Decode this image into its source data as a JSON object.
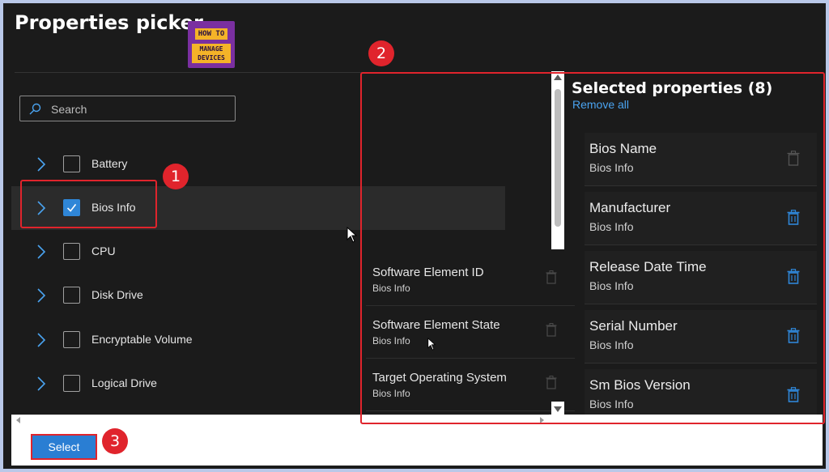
{
  "title": "Properties picker",
  "logo": {
    "line1": "HOW TO",
    "line2": "MANAGE",
    "line3": "DEVICES"
  },
  "search": {
    "placeholder": "Search"
  },
  "tree": [
    {
      "label": "Battery",
      "checked": false
    },
    {
      "label": "Bios Info",
      "checked": true
    },
    {
      "label": "CPU",
      "checked": false
    },
    {
      "label": "Disk Drive",
      "checked": false
    },
    {
      "label": "Encryptable Volume",
      "checked": false
    },
    {
      "label": "Logical Drive",
      "checked": false
    }
  ],
  "available": [
    {
      "name": "Software Element ID",
      "category": "Bios Info"
    },
    {
      "name": "Software Element State",
      "category": "Bios Info"
    },
    {
      "name": "Target Operating System",
      "category": "Bios Info"
    }
  ],
  "selected_panel": {
    "title": "Selected properties (8)",
    "remove_all": "Remove all",
    "items": [
      {
        "name": "Bios Name",
        "category": "Bios Info"
      },
      {
        "name": "Manufacturer",
        "category": "Bios Info"
      },
      {
        "name": "Release Date Time",
        "category": "Bios Info"
      },
      {
        "name": "Serial Number",
        "category": "Bios Info"
      },
      {
        "name": "Sm Bios Version",
        "category": "Bios Info"
      }
    ]
  },
  "footer": {
    "select_label": "Select"
  },
  "annotations": {
    "badge1": "1",
    "badge2": "2",
    "badge3": "3"
  },
  "colors": {
    "accent": "#2f86d7",
    "annotation": "#e0242c",
    "link": "#4aa3f0"
  }
}
